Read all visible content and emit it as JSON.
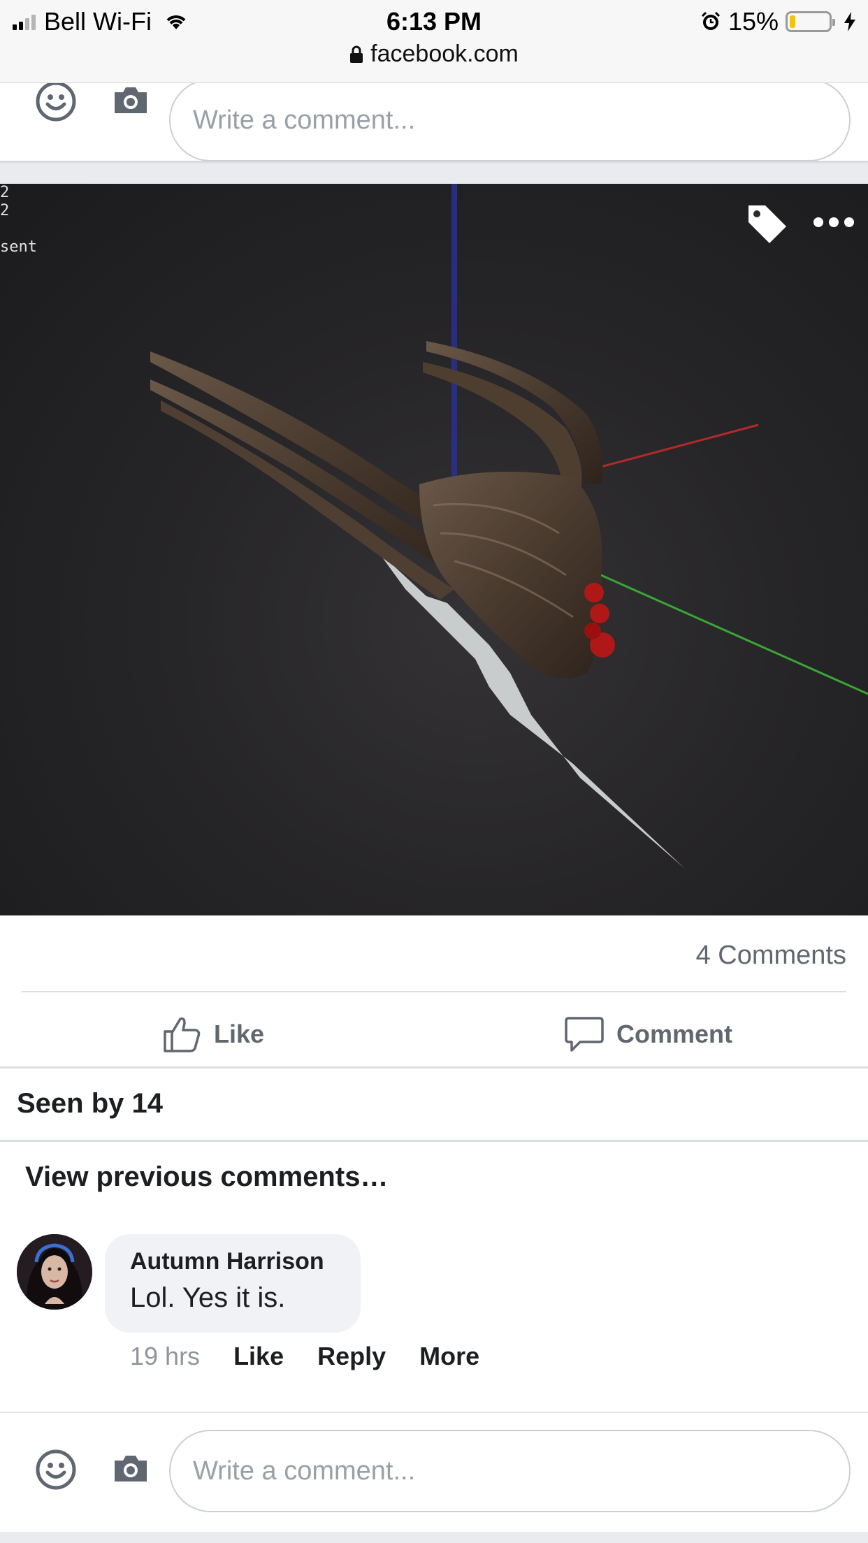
{
  "status_bar": {
    "carrier": "Bell Wi-Fi",
    "time": "6:13 PM",
    "battery_percent": "15%",
    "battery_level": 0.15,
    "url": "facebook.com"
  },
  "composer_top": {
    "placeholder": "Write a comment..."
  },
  "photo": {
    "overlay_text": [
      "2",
      "2",
      "",
      "sent"
    ],
    "tag_icon": "tag-icon",
    "more_icon": "ellipsis-icon"
  },
  "post": {
    "comments_count": "4 Comments",
    "like_label": "Like",
    "comment_label": "Comment",
    "seen_by": "Seen by 14",
    "view_previous": "View previous comments…"
  },
  "comment": {
    "author": "Autumn Harrison",
    "text": "Lol. Yes it is.",
    "time": "19 hrs",
    "like": "Like",
    "reply": "Reply",
    "more": "More"
  },
  "composer_bottom": {
    "placeholder": "Write a comment..."
  },
  "colors": {
    "facebook_gray_text": "#606770",
    "placeholder": "#9aa0a7",
    "battery_fill": "#f5c400",
    "divider": "#dadde1"
  }
}
